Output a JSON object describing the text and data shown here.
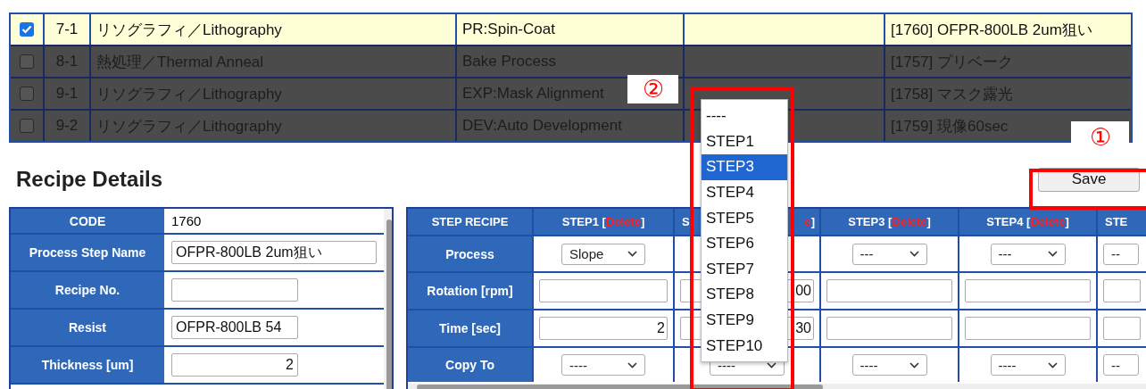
{
  "records": {
    "rows": [
      {
        "checked": true,
        "selected": true,
        "no": "7-1",
        "category": "リソグラフィ／Lithography",
        "process": "PR:Spin-Coat",
        "recipe": "[1760] OFPR-800LB 2um狙い"
      },
      {
        "checked": false,
        "selected": false,
        "no": "8-1",
        "category": "熱処理／Thermal Anneal",
        "process": "Bake Process",
        "recipe": "[1757] プリベーク"
      },
      {
        "checked": false,
        "selected": false,
        "no": "9-1",
        "category": "リソグラフィ／Lithography",
        "process": "EXP:Mask Alignment",
        "recipe": "[1758] マスク露光"
      },
      {
        "checked": false,
        "selected": false,
        "no": "9-2",
        "category": "リソグラフィ／Lithography",
        "process": "DEV:Auto Development",
        "recipe": "[1759] 現像60sec"
      }
    ]
  },
  "annotations": [
    {
      "mark": "②"
    },
    {
      "mark": "①"
    }
  ],
  "copy_to_dropdown": {
    "options": [
      {
        "label": "----",
        "selected": false
      },
      {
        "label": "STEP1",
        "selected": false
      },
      {
        "label": "STEP3",
        "selected": true
      },
      {
        "label": "STEP4",
        "selected": false
      },
      {
        "label": "STEP5",
        "selected": false
      },
      {
        "label": "STEP6",
        "selected": false
      },
      {
        "label": "STEP7",
        "selected": false
      },
      {
        "label": "STEP8",
        "selected": false
      },
      {
        "label": "STEP9",
        "selected": false
      },
      {
        "label": "STEP10",
        "selected": false
      }
    ]
  },
  "recipe_details": {
    "title": "Recipe Details",
    "save_button": "Save",
    "fields": [
      {
        "label": "CODE",
        "kind": "text",
        "value": "1760"
      },
      {
        "label": "Process Step Name",
        "kind": "input",
        "value": "OFPR-800LB 2um狙い"
      },
      {
        "label": "Recipe No.",
        "kind": "input"
      },
      {
        "label": "Resist",
        "kind": "input",
        "value": "OFPR-800LB 54"
      },
      {
        "label": "Thickness [um]",
        "kind": "number",
        "value": "2"
      }
    ]
  },
  "step_recipe": {
    "corner": "STEP RECIPE",
    "steps": [
      {
        "kind": "full",
        "label": "STEP1 [",
        "delete": "Delete",
        "close": "]"
      },
      {
        "kind": "cut",
        "label": "S",
        "delete": "e",
        "close": "]"
      },
      {
        "kind": "full",
        "label": "STEP3 [",
        "delete": "Delete",
        "close": "]"
      },
      {
        "kind": "full",
        "label": "STEP4 [",
        "delete": "Delete",
        "close": "]"
      },
      {
        "kind": "edge",
        "label": "STE"
      }
    ],
    "rows": [
      {
        "label": "Process",
        "kind": "select",
        "cells": [
          "Slope",
          null,
          "---",
          "---",
          "--"
        ]
      },
      {
        "label": "Rotation [rpm]",
        "kind": "input",
        "cells": [
          null,
          "00",
          null,
          null,
          null
        ]
      },
      {
        "label": "Time [sec]",
        "kind": "input",
        "cells": [
          "2",
          "30",
          null,
          null,
          null
        ]
      },
      {
        "label": "Copy To",
        "kind": "select",
        "cells": [
          "----",
          "----",
          "----",
          "----",
          "--"
        ]
      }
    ]
  }
}
